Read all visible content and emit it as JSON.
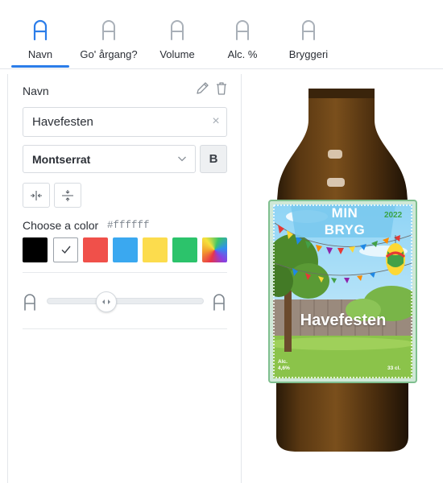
{
  "tabs": [
    {
      "label": "Navn",
      "active": true
    },
    {
      "label": "Go' årgang?",
      "active": false
    },
    {
      "label": "Volume",
      "active": false
    },
    {
      "label": "Alc. %",
      "active": false
    },
    {
      "label": "Bryggeri",
      "active": false
    }
  ],
  "editor": {
    "field_title": "Navn",
    "text_value": "Havefesten",
    "font": "Montserrat",
    "bold_label": "B",
    "color_label": "Choose a color",
    "color_value": "#ffffff",
    "swatches": [
      {
        "name": "black",
        "color": "#000000"
      },
      {
        "name": "white",
        "color": "#ffffff",
        "selected": true
      },
      {
        "name": "red",
        "color": "#f0504a"
      },
      {
        "name": "blue",
        "color": "#3aa8f0"
      },
      {
        "name": "yellow",
        "color": "#fcdc4d"
      },
      {
        "name": "green",
        "color": "#2cc36b"
      },
      {
        "name": "gradient",
        "color": "rainbow"
      }
    ],
    "size_level": 0.38
  },
  "label": {
    "line1": "MIN",
    "line2": "BRYG",
    "year": "2022",
    "name": "Havefesten",
    "alc": "Alc.\n4,6%",
    "alc_title": "Alc.",
    "alc_value": "4,6%",
    "volume": "33 cl."
  },
  "colors": {
    "accent": "#2b7de9",
    "tab_icon": "#a9b0b8",
    "bottle_glass": "#5a3812",
    "label_frame": "#7fbf8f"
  }
}
